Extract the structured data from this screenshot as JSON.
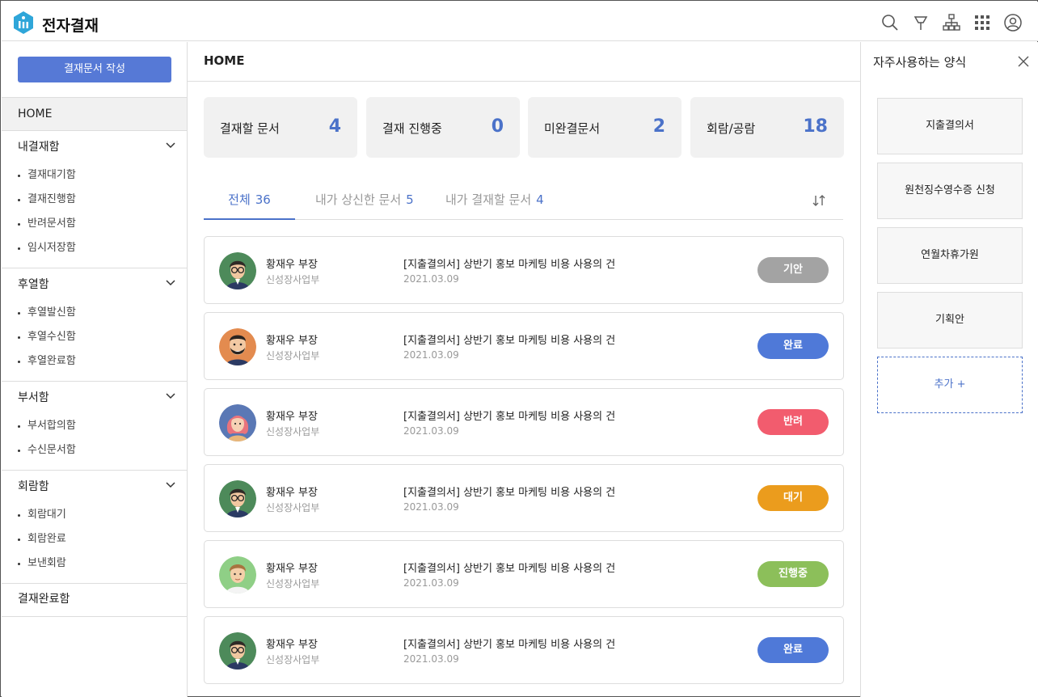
{
  "app": {
    "title": "전자결재"
  },
  "sidebar": {
    "write_button": "결재문서 작성",
    "home": "HOME",
    "groups": [
      {
        "title": "내결재함",
        "items": [
          "결재대기함",
          "결재진행함",
          "반려문서함",
          "임시저장함"
        ]
      },
      {
        "title": "후열함",
        "items": [
          "후열발신함",
          "후열수신함",
          "후열완료함"
        ]
      },
      {
        "title": "부서함",
        "items": [
          "부서합의함",
          "수신문서함"
        ]
      },
      {
        "title": "회람함",
        "items": [
          "회람대기",
          "회람완료",
          "보낸회람"
        ]
      }
    ],
    "done": "결재완료함"
  },
  "main": {
    "title": "HOME",
    "stats": [
      {
        "label": "결재할 문서",
        "value": "4"
      },
      {
        "label": "결재 진행중",
        "value": "0"
      },
      {
        "label": "미완결문서",
        "value": "2"
      },
      {
        "label": "회람/공람",
        "value": "18"
      }
    ],
    "tabs": [
      {
        "label": "전체",
        "count": "36"
      },
      {
        "label": "내가 상신한 문서",
        "count": "5"
      },
      {
        "label": "내가 결재할 문서",
        "count": "4"
      }
    ],
    "rows": [
      {
        "name": "황재우 부장",
        "dept": "신성장사업부",
        "title": "[지출결의서] 상반기 홍보 마케팅 비용 사용의 건",
        "date": "2021.03.09",
        "status": "기안",
        "status_color": "#a3a3a3",
        "avatar": "glasses-man"
      },
      {
        "name": "황재우 부장",
        "dept": "신성장사업부",
        "title": "[지출결의서] 상반기 홍보 마케팅 비용 사용의 건",
        "date": "2021.03.09",
        "status": "완료",
        "status_color": "#4f79d8",
        "avatar": "bearded-man"
      },
      {
        "name": "황재우 부장",
        "dept": "신성장사업부",
        "title": "[지출결의서] 상반기 홍보 마케팅 비용 사용의 건",
        "date": "2021.03.09",
        "status": "반려",
        "status_color": "#f25c6e",
        "avatar": "woman"
      },
      {
        "name": "황재우 부장",
        "dept": "신성장사업부",
        "title": "[지출결의서] 상반기 홍보 마케팅 비용 사용의 건",
        "date": "2021.03.09",
        "status": "대기",
        "status_color": "#eb9c1d",
        "avatar": "glasses-man"
      },
      {
        "name": "황재우 부장",
        "dept": "신성장사업부",
        "title": "[지출결의서] 상반기 홍보 마케팅 비용 사용의 건",
        "date": "2021.03.09",
        "status": "진행중",
        "status_color": "#8cbf5a",
        "avatar": "young-man"
      },
      {
        "name": "황재우 부장",
        "dept": "신성장사업부",
        "title": "[지출결의서] 상반기 홍보 마케팅 비용 사용의 건",
        "date": "2021.03.09",
        "status": "완료",
        "status_color": "#4f79d8",
        "avatar": "glasses-man"
      }
    ]
  },
  "right_panel": {
    "title": "자주사용하는 양식",
    "forms": [
      "지출결의서",
      "원천징수영수증 신청",
      "연월차휴가원",
      "기획안"
    ],
    "add": "추가 +"
  },
  "colors": {
    "accent": "#4b72c9",
    "button": "#5679d6"
  }
}
